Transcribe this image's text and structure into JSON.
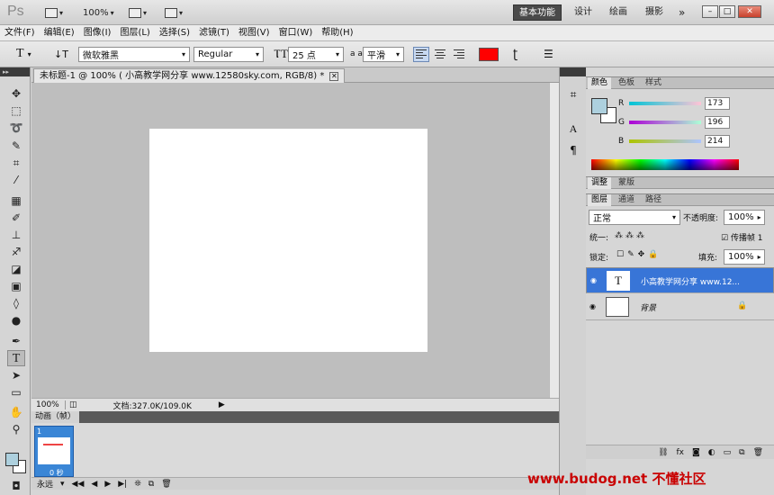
{
  "app": {
    "logo": "Ps",
    "zoom": "100%"
  },
  "workspaces": {
    "active": "基本功能",
    "items": [
      "设计",
      "绘画",
      "摄影"
    ],
    "more": "»"
  },
  "menu": [
    "文件(F)",
    "编辑(E)",
    "图像(I)",
    "图层(L)",
    "选择(S)",
    "滤镜(T)",
    "视图(V)",
    "窗口(W)",
    "帮助(H)"
  ],
  "options": {
    "font_family": "微软雅黑",
    "font_style": "Regular",
    "font_size": "25 点",
    "aa_label": "a a",
    "antialias": "平滑",
    "text_color": "#ff0000"
  },
  "document": {
    "tab_title": "未标题-1 @ 100% ( 小高教学网分享 www.12580sky.com, RGB/8) *",
    "zoom": "100%",
    "doc_info": "文档:327.0K/109.0K"
  },
  "animation": {
    "title": "动画（帧）",
    "frame_number": "1",
    "frame_time": "0 秒",
    "loop": "永远"
  },
  "color_panel": {
    "tabs": [
      "颜色",
      "色板",
      "样式"
    ],
    "channels": [
      {
        "label": "R",
        "value": "173"
      },
      {
        "label": "G",
        "value": "196"
      },
      {
        "label": "B",
        "value": "214"
      }
    ],
    "foreground": "#add0de"
  },
  "adjust_panel": {
    "tabs": [
      "调整",
      "蒙版"
    ]
  },
  "layers_panel": {
    "tabs": [
      "图层",
      "通道",
      "路径"
    ],
    "blend_mode": "正常",
    "opacity_label": "不透明度:",
    "opacity": "100%",
    "unify_label": "统一:",
    "propagate_label": "传播帧 1",
    "lock_label": "锁定:",
    "fill_label": "填充:",
    "fill": "100%",
    "layers": [
      {
        "name": "小高教学网分享 www.12...",
        "thumb": "T"
      },
      {
        "name": "背景",
        "thumb": ""
      }
    ]
  },
  "watermark": "www.budog.net 不懂社区"
}
